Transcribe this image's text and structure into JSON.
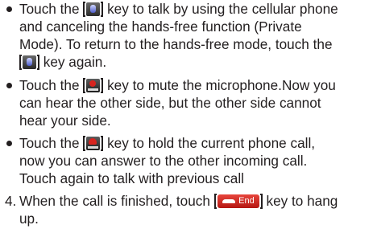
{
  "items": [
    {
      "type": "bullet",
      "lines": [
        {
          "before": "Touch the ",
          "icon": "private-mode-icon",
          "after": " key to talk by using the cellular phone"
        },
        {
          "text": "and canceling the hands-free function (Private"
        },
        {
          "text": "Mode). To return to the hands-free mode, touch the"
        },
        {
          "before": "",
          "icon": "private-mode-icon",
          "after": " key again."
        }
      ]
    },
    {
      "type": "bullet",
      "lines": [
        {
          "before": "Touch the ",
          "icon": "mute-icon",
          "after": " key to mute the microphone.Now you"
        },
        {
          "text": "can hear the other side, but the other side cannot"
        },
        {
          "text": "hear your side."
        }
      ]
    },
    {
      "type": "bullet",
      "lines": [
        {
          "before": "Touch the ",
          "icon": "hold-icon",
          "after": " key to hold the current phone call,"
        },
        {
          "text": "now you can answer to the other incoming call."
        },
        {
          "text": "Touch again to talk with previous call"
        }
      ]
    }
  ],
  "step4": {
    "number": "4.",
    "line1_before": "When the call is finished, touch ",
    "end_key_label": "End",
    "line1_after": " key to hang",
    "line2": "up."
  }
}
